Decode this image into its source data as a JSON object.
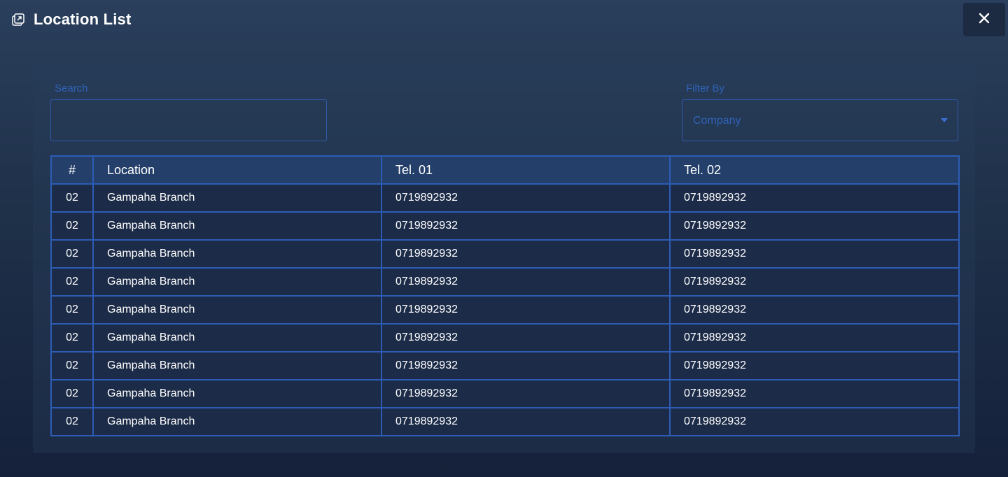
{
  "header": {
    "title": "Location List",
    "icon": "external-window-icon",
    "close_icon": "close-icon"
  },
  "filters": {
    "search_label": "Search",
    "search_value": "",
    "filter_label": "Filter By",
    "filter_selected": "Company"
  },
  "table": {
    "columns": [
      "#",
      "Location",
      "Tel. 01",
      "Tel. 02"
    ],
    "rows": [
      {
        "num": "02",
        "location": "Gampaha Branch",
        "tel1": "0719892932",
        "tel2": "0719892932"
      },
      {
        "num": "02",
        "location": "Gampaha Branch",
        "tel1": "0719892932",
        "tel2": "0719892932"
      },
      {
        "num": "02",
        "location": "Gampaha Branch",
        "tel1": "0719892932",
        "tel2": "0719892932"
      },
      {
        "num": "02",
        "location": "Gampaha Branch",
        "tel1": "0719892932",
        "tel2": "0719892932"
      },
      {
        "num": "02",
        "location": "Gampaha Branch",
        "tel1": "0719892932",
        "tel2": "0719892932"
      },
      {
        "num": "02",
        "location": "Gampaha Branch",
        "tel1": "0719892932",
        "tel2": "0719892932"
      },
      {
        "num": "02",
        "location": "Gampaha Branch",
        "tel1": "0719892932",
        "tel2": "0719892932"
      },
      {
        "num": "02",
        "location": "Gampaha Branch",
        "tel1": "0719892932",
        "tel2": "0719892932"
      },
      {
        "num": "02",
        "location": "Gampaha Branch",
        "tel1": "0719892932",
        "tel2": "0719892932"
      }
    ]
  },
  "colors": {
    "accent_border": "#2d5cb5",
    "label_blue": "#2f62b8",
    "header_row_bg": "#24406a",
    "row_bg": "#1c2b48"
  }
}
